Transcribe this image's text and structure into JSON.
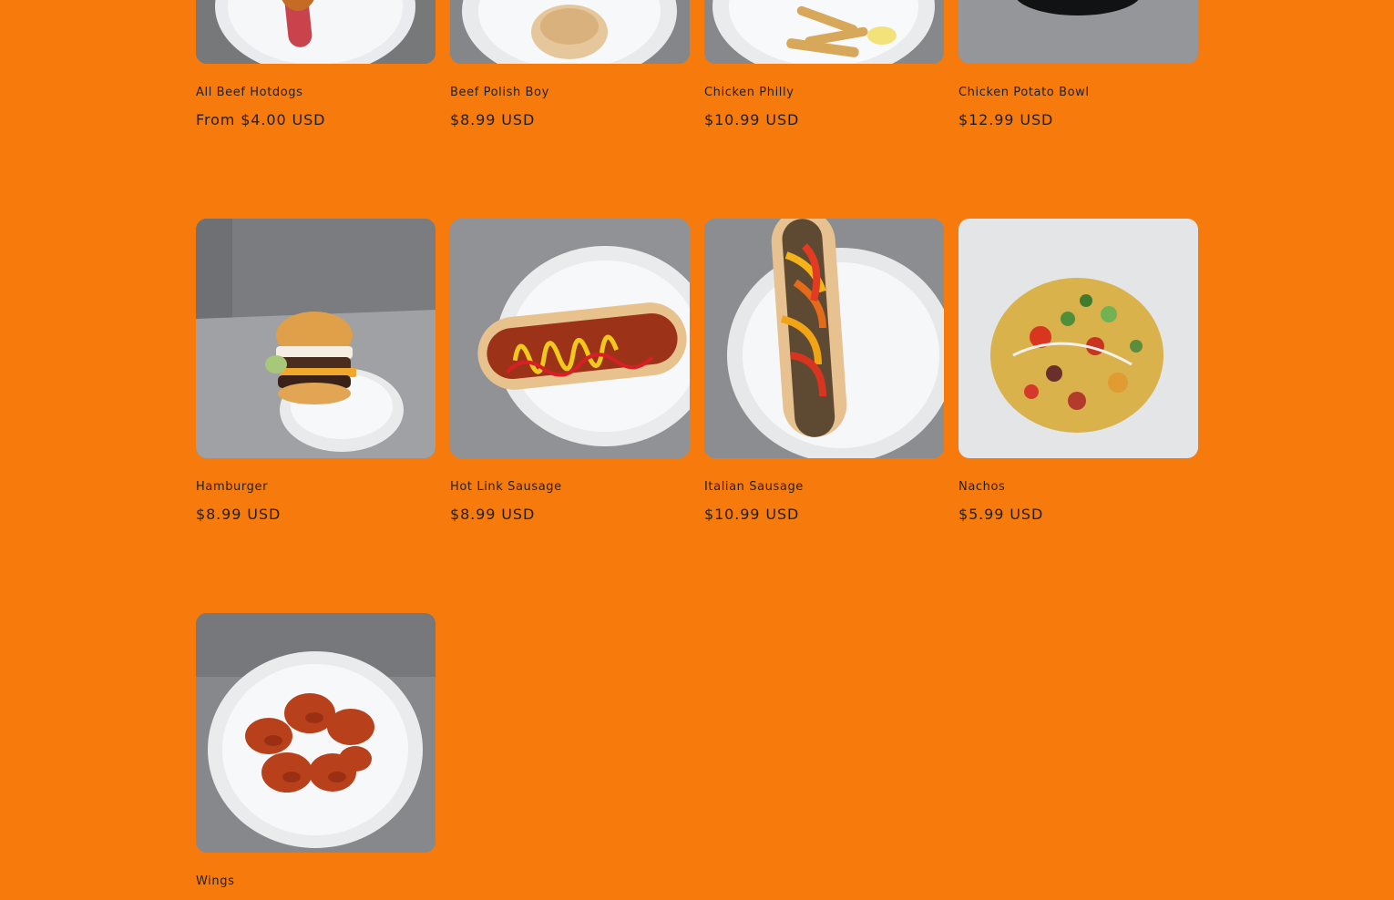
{
  "products": [
    {
      "title": "All Beef Hotdogs",
      "price": "From $4.00 USD",
      "image": "hotdog-with-chili-plate"
    },
    {
      "title": "Beef Polish Boy",
      "price": "$8.99 USD",
      "image": "polish-sausage-plate"
    },
    {
      "title": "Chicken Philly",
      "price": "$10.99 USD",
      "image": "fries-plate"
    },
    {
      "title": "Chicken Potato Bowl",
      "price": "$12.99 USD",
      "image": "black-bowl"
    },
    {
      "title": "Hamburger",
      "price": "$8.99 USD",
      "image": "cheeseburger-plate"
    },
    {
      "title": "Hot Link Sausage",
      "price": "$8.99 USD",
      "image": "hot-link-mustard-ketchup"
    },
    {
      "title": "Italian Sausage",
      "price": "$10.99 USD",
      "image": "italian-sausage-peppers"
    },
    {
      "title": "Nachos",
      "price": "$5.99 USD",
      "image": "loaded-nachos"
    },
    {
      "title": "Wings",
      "price": "",
      "image": "buffalo-wings-plate"
    }
  ],
  "colors": {
    "background": "#f77b0c",
    "text": "#1f1f1f"
  }
}
